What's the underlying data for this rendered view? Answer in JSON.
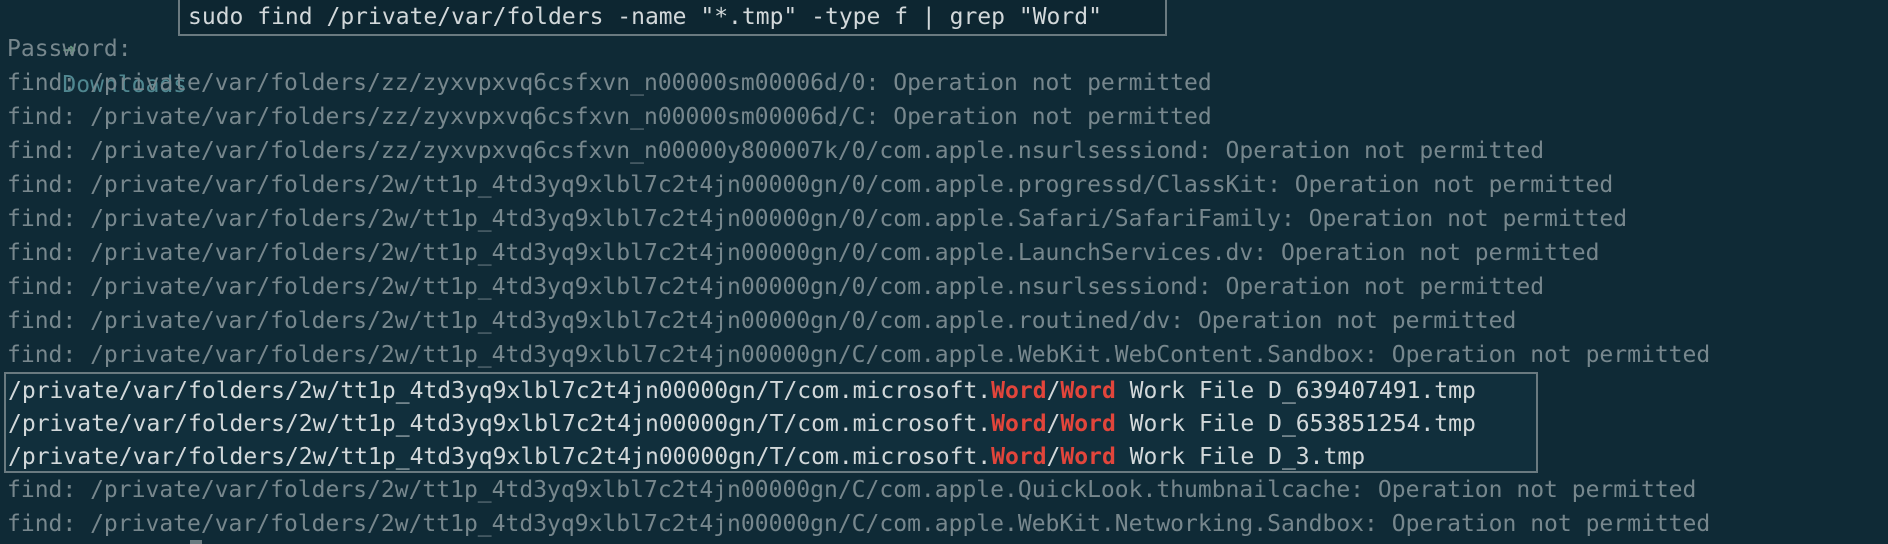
{
  "prompt": {
    "arrow": "➜",
    "directory": "Downloads",
    "command": "sudo find /private/var/folders -name \"*.tmp\" -type f | grep \"Word\""
  },
  "password_prompt": "Password:",
  "errors_before": [
    "find: /private/var/folders/zz/zyxvpxvq6csfxvn_n00000sm00006d/0: Operation not permitted",
    "find: /private/var/folders/zz/zyxvpxvq6csfxvn_n00000sm00006d/C: Operation not permitted",
    "find: /private/var/folders/zz/zyxvpxvq6csfxvn_n00000y800007k/0/com.apple.nsurlsessiond: Operation not permitted",
    "find: /private/var/folders/2w/tt1p_4td3yq9xlbl7c2t4jn00000gn/0/com.apple.progressd/ClassKit: Operation not permitted",
    "find: /private/var/folders/2w/tt1p_4td3yq9xlbl7c2t4jn00000gn/0/com.apple.Safari/SafariFamily: Operation not permitted",
    "find: /private/var/folders/2w/tt1p_4td3yq9xlbl7c2t4jn00000gn/0/com.apple.LaunchServices.dv: Operation not permitted",
    "find: /private/var/folders/2w/tt1p_4td3yq9xlbl7c2t4jn00000gn/0/com.apple.nsurlsessiond: Operation not permitted",
    "find: /private/var/folders/2w/tt1p_4td3yq9xlbl7c2t4jn00000gn/0/com.apple.routined/dv: Operation not permitted",
    "find: /private/var/folders/2w/tt1p_4td3yq9xlbl7c2t4jn00000gn/C/com.apple.WebKit.WebContent.Sandbox: Operation not permitted"
  ],
  "matches": [
    {
      "prefix": "/private/var/folders/2w/tt1p_4td3yq9xlbl7c2t4jn00000gn/T/com.microsoft.",
      "word1": "Word",
      "sep": "/",
      "word2": "Word",
      "suffix": " Work File D_639407491.tmp"
    },
    {
      "prefix": "/private/var/folders/2w/tt1p_4td3yq9xlbl7c2t4jn00000gn/T/com.microsoft.",
      "word1": "Word",
      "sep": "/",
      "word2": "Word",
      "suffix": " Work File D_653851254.tmp"
    },
    {
      "prefix": "/private/var/folders/2w/tt1p_4td3yq9xlbl7c2t4jn00000gn/T/com.microsoft.",
      "word1": "Word",
      "sep": "/",
      "word2": "Word",
      "suffix": " Work File D_3.tmp"
    }
  ],
  "errors_after": [
    "find: /private/var/folders/2w/tt1p_4td3yq9xlbl7c2t4jn00000gn/C/com.apple.QuickLook.thumbnailcache: Operation not permitted",
    "find: /private/var/folders/2w/tt1p_4td3yq9xlbl7c2t4jn00000gn/C/com.apple.WebKit.Networking.Sandbox: Operation not permitted"
  ],
  "colors": {
    "background": "#0f2a36",
    "highlight": "#e2453b",
    "prompt_arrow": "#5f9178",
    "prompt_dir": "#4f8790"
  }
}
